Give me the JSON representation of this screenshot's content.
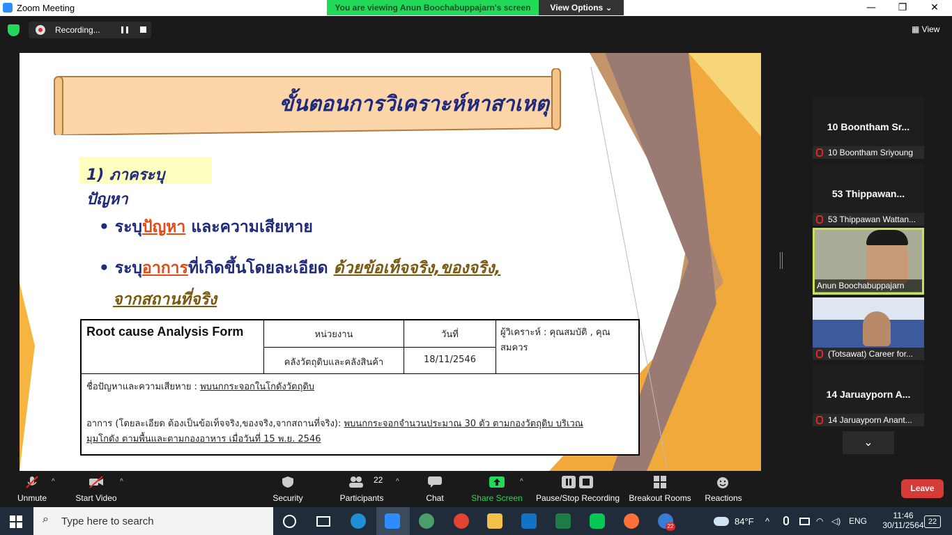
{
  "window": {
    "title": "Zoom Meeting"
  },
  "banner": {
    "viewing_text": "You are viewing Anun Boochabuppajarn's screen",
    "view_options": "View Options ⌄"
  },
  "recording": {
    "label": "Recording..."
  },
  "view_button": "View",
  "slide": {
    "title": "ขั้นตอนการวิเคราะห์หาสาเหตุ",
    "step": "1) ภาคระบุปัญหา",
    "b1_pre": "ระบุ",
    "b1_hl": "ปัญหา",
    "b1_post": " และความเสียหาย",
    "b2_pre": "ระบุ",
    "b2_hl": "อาการ",
    "b2_mid": "ที่เกิดขึ้นโดยละเอียด ",
    "b2_gold1": "ด้วยข้อเท็จจริง,ของจริง,",
    "b2_gold2": "จากสถานที่จริง",
    "form": {
      "heading": "Root cause Analysis Form",
      "col_unit": "หน่วยงาน",
      "col_date": "วันที่",
      "analyst": "ผู้วิเคราะห์ : คุณสมบัติ , คุณสมควร",
      "unit_val": "คลังวัตถุดิบและคลังสินค้า",
      "date_val": "18/11/2546",
      "problem_label": "ชื่อปัญหาและความเสียหาย : ",
      "problem_val": "พบนกกระจอกในโกดังวัตถุดิบ",
      "symptom_label": "อาการ (โดยละเอียด ต้องเป็นข้อเท็จจริง,ของจริง,จากสถานที่จริง): ",
      "symptom_val1": "พบนกกระจอกจำนวนประมาณ 30 ตัว ตามกองวัตถุดิบ บริเวณ",
      "symptom_val2": "มุมโกดัง ตามพื้นและตามกองอาหาร เมื่อวันที่ 15 พ.ย. 2546"
    }
  },
  "participants_panel": [
    {
      "tile_name": "10  Boontham Sr...",
      "caption": "10 Boontham Sriyoung"
    },
    {
      "tile_name": "53  Thippawan...",
      "caption": "53 Thippawan Wattan..."
    },
    {
      "caption": "Anun Boochabuppajarn"
    },
    {
      "caption": "(Totsawat) Career for..."
    },
    {
      "tile_name": "14  Jaruayporn A...",
      "caption": "14 Jaruayporn Anant..."
    }
  ],
  "toolbar": {
    "unmute": "Unmute",
    "start_video": "Start Video",
    "security": "Security",
    "participants": "Participants",
    "participants_count": "22",
    "chat": "Chat",
    "share": "Share Screen",
    "recording": "Pause/Stop Recording",
    "breakout": "Breakout Rooms",
    "reactions": "Reactions",
    "leave": "Leave"
  },
  "taskbar": {
    "search_placeholder": "Type here to search",
    "weather": "84°F",
    "lang": "ENG",
    "time": "11:46",
    "date": "30/11/2564",
    "notif": "22",
    "badge": "22"
  },
  "colors": {
    "share_green": "#23d959",
    "leave_red": "#d63b37",
    "slide_navy": "#1f2b7a",
    "accent_orange": "#e34b17"
  }
}
